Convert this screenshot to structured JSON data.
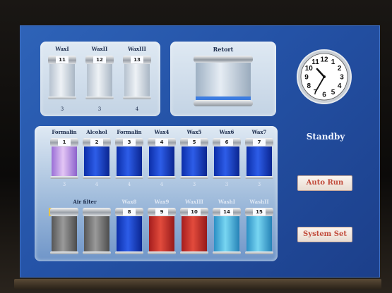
{
  "top_tanks": [
    {
      "label": "WaxI",
      "number": "11",
      "count": "3"
    },
    {
      "label": "WaxII",
      "number": "12",
      "count": "3"
    },
    {
      "label": "WaxIII",
      "number": "13",
      "count": "4"
    }
  ],
  "retort": {
    "label": "Retort"
  },
  "row1": [
    {
      "label": "Formalin",
      "number": "1",
      "count": "3",
      "fill": "purple"
    },
    {
      "label": "Alcohol",
      "number": "2",
      "count": "4",
      "fill": "blue"
    },
    {
      "label": "Formalin",
      "number": "3",
      "count": "4",
      "fill": "blue"
    },
    {
      "label": "Wax4",
      "number": "4",
      "count": "4",
      "fill": "blue"
    },
    {
      "label": "Wax5",
      "number": "5",
      "count": "3",
      "fill": "blue"
    },
    {
      "label": "Wax6",
      "number": "6",
      "count": "3",
      "fill": "blue"
    },
    {
      "label": "Wax7",
      "number": "7",
      "count": "3",
      "fill": "blue"
    }
  ],
  "row2": {
    "group_label": "Air filter",
    "tanks": [
      {
        "label": "",
        "number": "",
        "count": "",
        "fill": "gray"
      },
      {
        "label": "",
        "number": "",
        "count": "",
        "fill": "gray"
      },
      {
        "label": "Wax8",
        "number": "8",
        "count": "",
        "fill": "blue"
      },
      {
        "label": "Wax9",
        "number": "9",
        "count": "",
        "fill": "red"
      },
      {
        "label": "WaxIII",
        "number": "10",
        "count": "",
        "fill": "red"
      },
      {
        "label": "WashI",
        "number": "14",
        "count": "",
        "fill": "cyan"
      },
      {
        "label": "WashII",
        "number": "15",
        "count": "",
        "fill": "cyan"
      }
    ]
  },
  "clock": {
    "hour": 10,
    "minute": 35,
    "numbers": [
      "12",
      "1",
      "2",
      "3",
      "4",
      "5",
      "6",
      "7",
      "8",
      "9",
      "10",
      "11"
    ]
  },
  "status": "Standby",
  "buttons": {
    "auto_run": "Auto Run",
    "system_set": "System Set"
  },
  "colors": {
    "screen": "#2a5cb0",
    "purple": "#c9a3ef",
    "blue": "#1d46d0",
    "red": "#cf3a30",
    "cyan": "#58c0e6",
    "gray": "#7a7a7a",
    "button_text": "#c14a3a"
  }
}
